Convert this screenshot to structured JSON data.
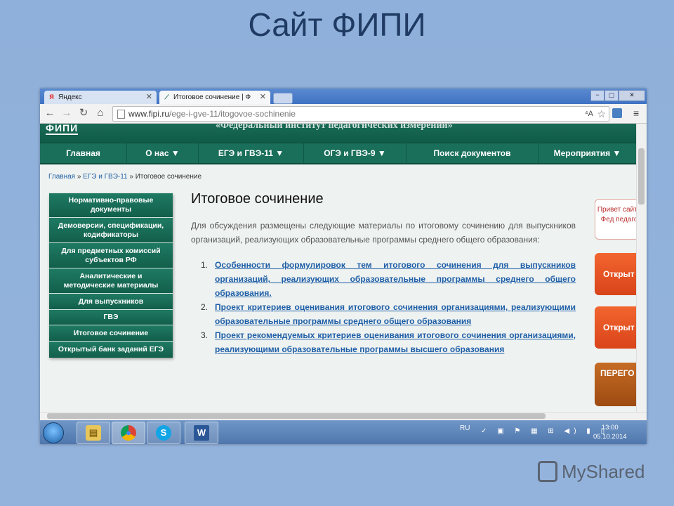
{
  "slide": {
    "title": "Сайт ФИПИ"
  },
  "browser": {
    "tabs": [
      {
        "favicon": "Я",
        "label": "Яндекс"
      },
      {
        "favicon": "⟋",
        "label": "Итоговое сочинение | Ф"
      }
    ],
    "url_domain": "www.fipi.ru",
    "url_path": "/ege-i-gve-11/itogovoe-sochinenie",
    "translate_icon": "translate-icon",
    "window_buttons": [
      "−",
      "▢",
      "✕"
    ]
  },
  "site": {
    "logo": "ФИПИ",
    "header_text": "«Федеральный институт педагогических измерений»",
    "nav": [
      {
        "label": "Главная"
      },
      {
        "label": "О нас ▼"
      },
      {
        "label": "ЕГЭ и ГВЭ-11 ▼"
      },
      {
        "label": "ОГЭ и ГВЭ-9 ▼"
      },
      {
        "label": "Поиск документов"
      },
      {
        "label": "Мероприятия ▼"
      }
    ],
    "breadcrumbs": {
      "home": "Главная",
      "sep": "»",
      "section": "ЕГЭ и ГВЭ-11",
      "current": "Итоговое сочинение"
    },
    "sidebar": [
      "Нормативно-правовые документы",
      "Демоверсии, спецификации, кодификаторы",
      "Для предметных комиссий субъектов РФ",
      "Аналитические и методические материалы",
      "Для выпускников",
      "ГВЭ",
      "Итоговое сочинение",
      "Открытый банк заданий ЕГЭ"
    ],
    "page_title": "Итоговое сочинение",
    "intro": "Для обсуждения размещены следующие материалы по итоговому сочинению для выпускников организаций, реализующих образовательные программы среднего общего образования:",
    "items": [
      {
        "num": "1.",
        "text": "Особенности формулировок тем итогового сочинения для выпускников организаций, реализующих образовательные программы среднего общего образования."
      },
      {
        "num": "2.",
        "text": "Проект критериев оценивания итогового сочинения организациями, реализующими образовательные программы среднего общего образования"
      },
      {
        "num": "3.",
        "text": "Проект рекомендуемых критериев оценивания итогового сочинения организациями, реализующими образовательные программы высшего образования"
      }
    ],
    "right_widgets": {
      "greeting": "Привет сайте Фед педаго",
      "open1": "Открыт",
      "open2": "Открыт",
      "banner": "ПЕРЕГО"
    }
  },
  "taskbar": {
    "apps": [
      {
        "icon": "folder-icon",
        "glyph": "▤"
      },
      {
        "icon": "chrome-icon",
        "glyph": "●"
      },
      {
        "icon": "skype-icon",
        "glyph": "S"
      },
      {
        "icon": "word-icon",
        "glyph": "W"
      }
    ],
    "lang": "RU",
    "tray": "✓ ▣ ⚑ ▦ ⊞ ◀) ▮ ▯",
    "time": "13:00",
    "date": "05.10.2014"
  },
  "watermark": "MyShared"
}
